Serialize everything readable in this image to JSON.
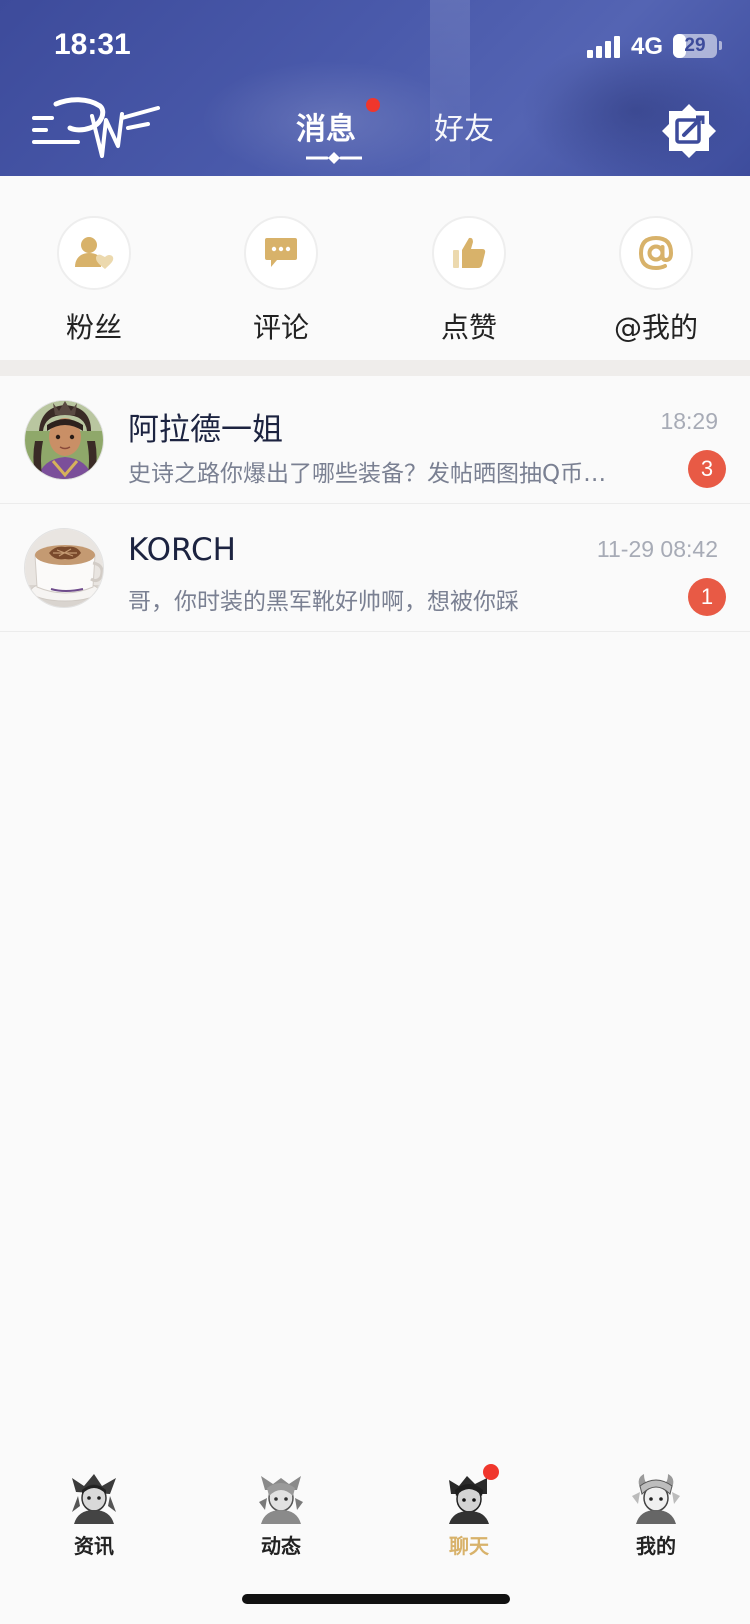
{
  "status_bar": {
    "time": "18:31",
    "network": "4G",
    "battery": "29",
    "battery_level": 0.29
  },
  "header": {
    "tabs": [
      {
        "label": "消息",
        "active": true,
        "has_dot": true
      },
      {
        "label": "好友",
        "active": false,
        "has_dot": false
      }
    ],
    "menu_icon": "menu-logo-icon",
    "edit_icon": "edit-icon"
  },
  "quick_actions": [
    {
      "label": "粉丝",
      "icon": "fans-icon"
    },
    {
      "label": "评论",
      "icon": "comment-icon"
    },
    {
      "label": "点赞",
      "icon": "like-icon"
    },
    {
      "label": "@我的",
      "icon": "mention-icon"
    }
  ],
  "conversations": [
    {
      "name": "阿拉德一姐",
      "time": "18:29",
      "preview": "史诗之路你爆出了哪些装备？发帖晒图抽Q币…",
      "unread": "3"
    },
    {
      "name": "KORCH",
      "time": "11-29 08:42",
      "preview": "哥，你时装的黑军靴好帅啊，想被你踩",
      "unread": "1"
    }
  ],
  "bottom_nav": [
    {
      "label": "资讯",
      "active": false
    },
    {
      "label": "动态",
      "active": false
    },
    {
      "label": "聊天",
      "active": true,
      "has_dot": true
    },
    {
      "label": "我的",
      "active": false
    }
  ],
  "colors": {
    "header_blue": "#3d4b9b",
    "accent_gold": "#d8b26a",
    "badge_red": "#e85a45",
    "dot_red": "#f0362c"
  }
}
